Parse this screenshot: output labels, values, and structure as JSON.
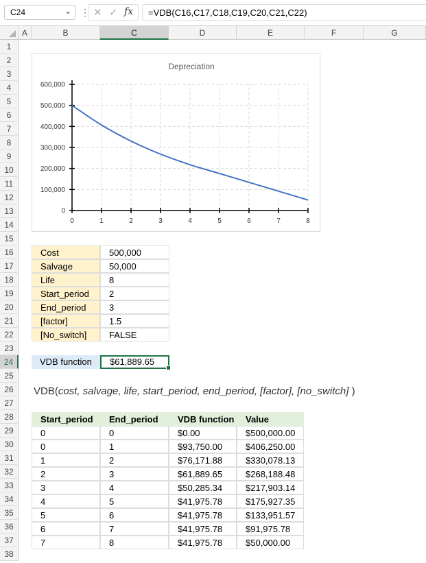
{
  "formula_bar": {
    "name_box": "C24",
    "formula": "=VDB(C16,C17,C18,C19,C20,C21,C22)",
    "fx_label": "fx"
  },
  "columns": [
    "A",
    "B",
    "C",
    "D",
    "E",
    "F",
    "G"
  ],
  "selected_column": "C",
  "rows": [
    "1",
    "2",
    "3",
    "4",
    "5",
    "6",
    "7",
    "8",
    "9",
    "10",
    "11",
    "12",
    "13",
    "14",
    "15",
    "16",
    "17",
    "18",
    "19",
    "20",
    "21",
    "22",
    "23",
    "24",
    "25",
    "26",
    "27",
    "28",
    "29",
    "30",
    "31",
    "32",
    "33",
    "34",
    "35",
    "36",
    "37",
    "38"
  ],
  "selected_row": "24",
  "inputs": [
    {
      "label": "Cost",
      "value": "500,000"
    },
    {
      "label": "Salvage",
      "value": "50,000"
    },
    {
      "label": "Life",
      "value": "8"
    },
    {
      "label": "Start_period",
      "value": "2"
    },
    {
      "label": "End_period",
      "value": "3"
    },
    {
      "label": "[factor]",
      "value": "1.5"
    },
    {
      "label": "[No_switch]",
      "value": "FALSE"
    }
  ],
  "result": {
    "label": "VDB function",
    "value": "$61,889.65"
  },
  "syntax": {
    "prefix": "VDB(",
    "args": "cost, salvage, life, start_period, end_period, [factor], [no_switch]",
    "suffix": " )"
  },
  "table": {
    "headers": [
      "Start_period",
      "End_period",
      "VDB function",
      "Value"
    ],
    "rows": [
      [
        "0",
        "0",
        "$0.00",
        "$500,000.00"
      ],
      [
        "0",
        "1",
        "$93,750.00",
        "$406,250.00"
      ],
      [
        "1",
        "2",
        "$76,171.88",
        "$330,078.13"
      ],
      [
        "2",
        "3",
        "$61,889.65",
        "$268,188.48"
      ],
      [
        "3",
        "4",
        "$50,285.34",
        "$217,903.14"
      ],
      [
        "4",
        "5",
        "$41,975.78",
        "$175,927.35"
      ],
      [
        "5",
        "6",
        "$41,975.78",
        "$133,951.57"
      ],
      [
        "6",
        "7",
        "$41,975.78",
        "$91,975.78"
      ],
      [
        "7",
        "8",
        "$41,975.78",
        "$50,000.00"
      ]
    ]
  },
  "chart_data": {
    "type": "line",
    "title": "Depreciation",
    "xlabel": "",
    "ylabel": "",
    "x": [
      0,
      1,
      2,
      3,
      4,
      5,
      6,
      7,
      8
    ],
    "x_tick_labels": [
      "0",
      "1",
      "2",
      "3",
      "4",
      "5",
      "6",
      "7",
      "8"
    ],
    "y_tick_labels": [
      "0",
      "100,000",
      "200,000",
      "300,000",
      "400,000",
      "500,000",
      "600,000"
    ],
    "ylim": [
      0,
      600000
    ],
    "xlim": [
      0,
      8
    ],
    "series": [
      {
        "values": [
          500000,
          406250,
          330078.13,
          268188.48,
          217903.14,
          175927.35,
          133951.57,
          91975.78,
          50000
        ],
        "color": "#4472c4"
      }
    ],
    "grid": "dashed vertical and horizontal",
    "legend": "none"
  }
}
